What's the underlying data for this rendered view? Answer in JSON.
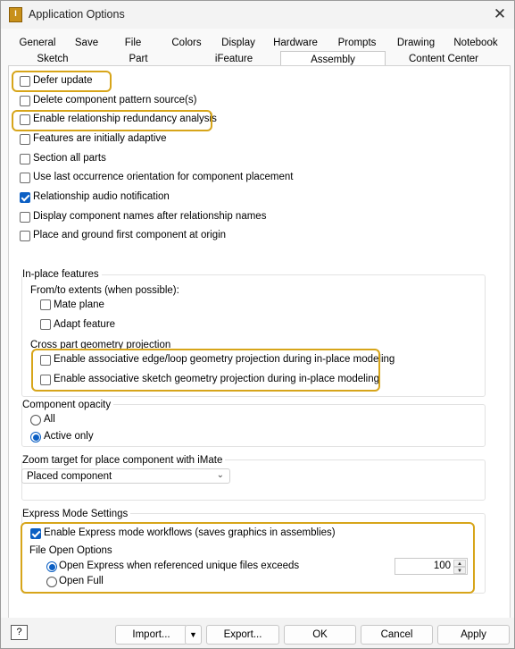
{
  "window": {
    "title": "Application Options",
    "app_icon_text": "I"
  },
  "tabs_row1": [
    "General",
    "Save",
    "File",
    "Colors",
    "Display",
    "Hardware",
    "Prompts",
    "Drawing",
    "Notebook"
  ],
  "tabs_row2": [
    "Sketch",
    "Part",
    "iFeature",
    "Assembly",
    "Content Center"
  ],
  "active_tab": "Assembly",
  "options": [
    {
      "label": "Defer update",
      "checked": false
    },
    {
      "label": "Delete component pattern source(s)",
      "checked": false
    },
    {
      "label": "Enable relationship redundancy analysis",
      "checked": false
    },
    {
      "label": "Features are initially adaptive",
      "checked": false
    },
    {
      "label": "Section all parts",
      "checked": false
    },
    {
      "label": "Use last occurrence orientation for component placement",
      "checked": false
    },
    {
      "label": "Relationship audio notification",
      "checked": true
    },
    {
      "label": "Display component names after relationship names",
      "checked": false
    },
    {
      "label": "Place and ground first component at origin",
      "checked": false
    }
  ],
  "inplace": {
    "title": "In-place features",
    "extents_label": "From/to extents (when possible):",
    "mate_plane": "Mate plane",
    "adapt_feature": "Adapt feature",
    "cross_part_label": "Cross part geometry projection",
    "edge_loop": "Enable associative edge/loop geometry projection during in-place modeling",
    "sketch_geom": "Enable associative sketch geometry projection during in-place modeling"
  },
  "opacity": {
    "title": "Component opacity",
    "all": "All",
    "active_only": "Active only",
    "selected": "Active only"
  },
  "zoom": {
    "title": "Zoom target for place component with iMate",
    "value": "Placed component"
  },
  "express": {
    "title": "Express Mode Settings",
    "enable_label": "Enable Express mode workflows (saves graphics in assemblies)",
    "enable_checked": true,
    "file_open_label": "File Open Options",
    "open_express_label": "Open Express when referenced unique files exceeds",
    "open_full_label": "Open Full",
    "threshold": "100"
  },
  "buttons": {
    "help": "?",
    "import": "Import...",
    "import_arrow": "▼",
    "export": "Export...",
    "ok": "OK",
    "cancel": "Cancel",
    "apply": "Apply"
  },
  "colors": {
    "accent": "#0b5fc4",
    "highlight": "#d7a51a"
  }
}
